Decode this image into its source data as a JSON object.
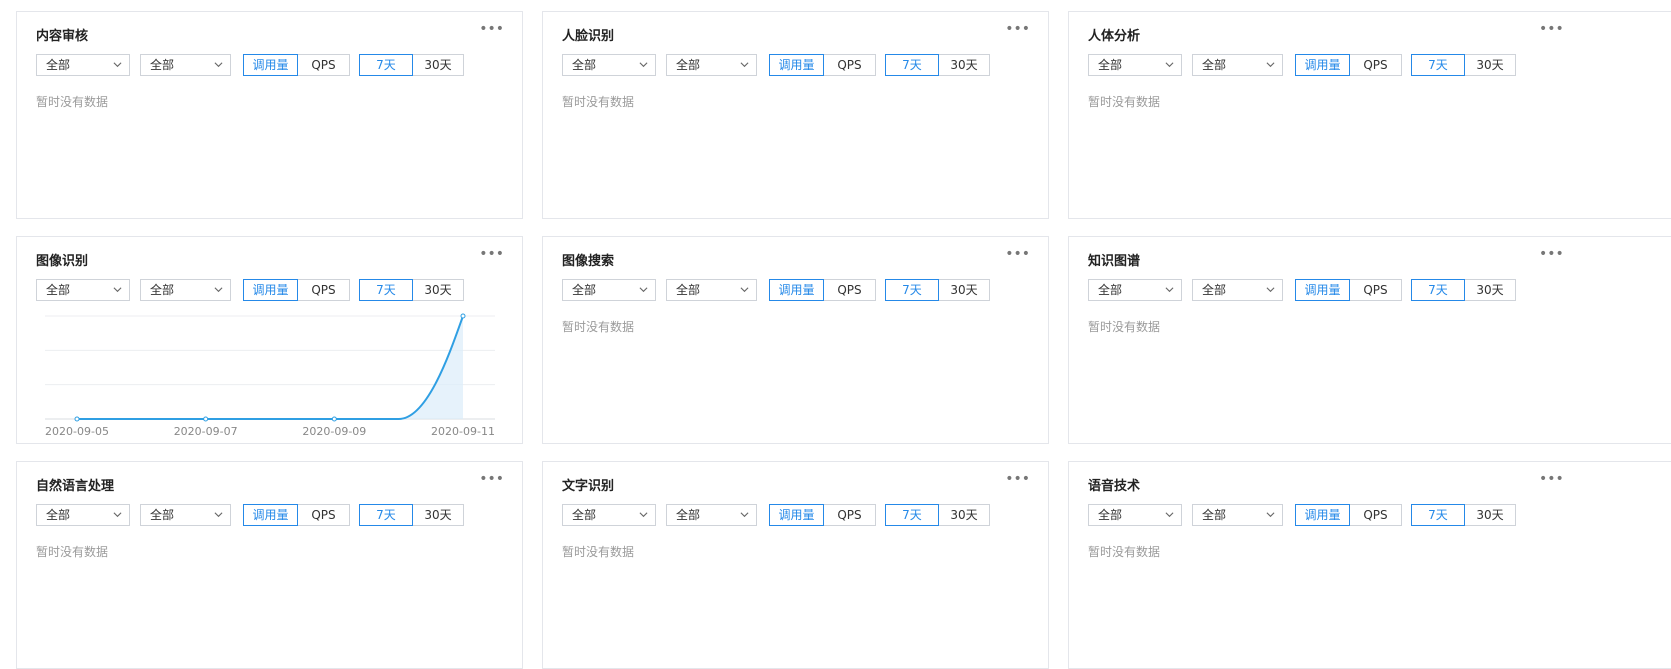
{
  "controls": {
    "select1": "全部",
    "select2": "全部",
    "metric_options": [
      "调用量",
      "QPS"
    ],
    "range_options": [
      "7天",
      "30天"
    ],
    "no_data": "暂时没有数据",
    "more": "•••"
  },
  "colors": {
    "accent": "#2589e8",
    "line": "#2f9fe3",
    "border": "#e4e6eb"
  },
  "cards": [
    {
      "title": "内容审核"
    },
    {
      "title": "人脸识别"
    },
    {
      "title": "人体分析"
    },
    {
      "title": "图像识别"
    },
    {
      "title": "图像搜索"
    },
    {
      "title": "知识图谱"
    },
    {
      "title": "自然语言处理"
    },
    {
      "title": "文字识别"
    },
    {
      "title": "语音技术"
    }
  ],
  "chart_data": {
    "type": "line",
    "x": [
      "2020-09-05",
      "2020-09-06",
      "2020-09-07",
      "2020-09-08",
      "2020-09-09",
      "2020-09-10",
      "2020-09-11"
    ],
    "values": [
      0,
      0,
      0,
      0,
      0,
      0,
      3
    ],
    "tick_labels": [
      "2020-09-05",
      "2020-09-07",
      "2020-09-09",
      "2020-09-11"
    ],
    "ylim": [
      0,
      3
    ],
    "grid": true
  }
}
